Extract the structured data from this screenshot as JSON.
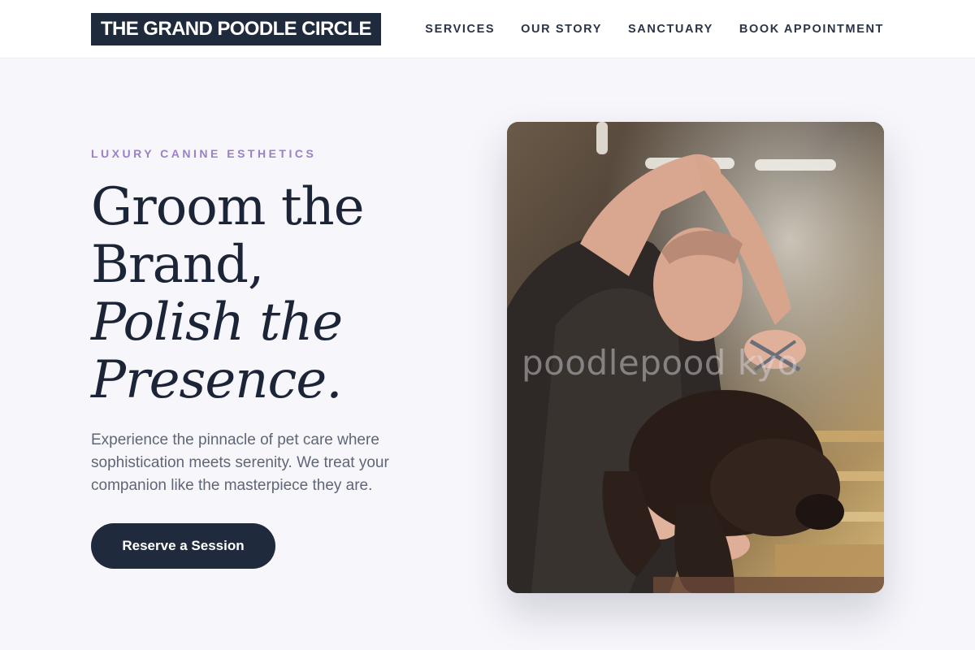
{
  "header": {
    "logo_text": "THE GRAND POODLE CIRCLE",
    "nav": [
      {
        "label": "SERVICES"
      },
      {
        "label": "OUR STORY"
      },
      {
        "label": "SANCTUARY"
      },
      {
        "label": "BOOK APPOINTMENT"
      }
    ]
  },
  "hero": {
    "eyebrow": "LUXURY CANINE ESTHETICS",
    "headline": {
      "line1": "Groom the",
      "line2": "Brand,",
      "line3": "Polish the",
      "line4": "Presence."
    },
    "lede": "Experience the pinnacle of pet care where sophistication meets serenity. We treat your companion like the masterpiece they are.",
    "cta_label": "Reserve a Session",
    "photo": {
      "watermark": "poodlepood  kyo"
    }
  },
  "colors": {
    "navy": "#1f2a3d",
    "accent": "#9b7fc9",
    "background": "#f7f6fb"
  }
}
